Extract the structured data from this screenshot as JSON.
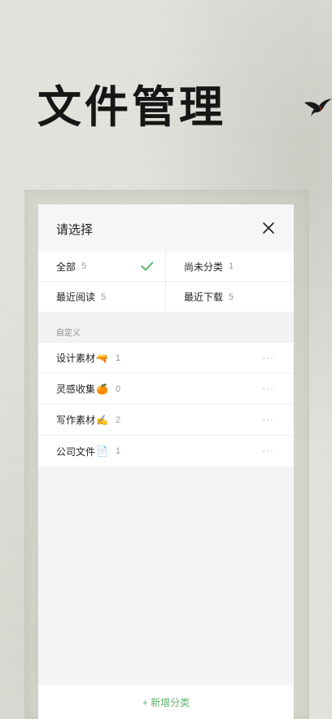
{
  "page": {
    "title": "文件管理"
  },
  "sheet": {
    "title": "请选择",
    "close_icon": "close-icon"
  },
  "filters": [
    {
      "label": "全部",
      "count": "5",
      "selected": true
    },
    {
      "label": "尚未分类",
      "count": "1",
      "selected": false
    },
    {
      "label": "最近阅读",
      "count": "5",
      "selected": false
    },
    {
      "label": "最近下载",
      "count": "5",
      "selected": false
    }
  ],
  "custom": {
    "section_label": "自定义",
    "items": [
      {
        "label": "设计素材",
        "emoji": "🔫",
        "count": "1",
        "more": "···"
      },
      {
        "label": "灵感收集",
        "emoji": "🍊",
        "count": "0",
        "more": "···"
      },
      {
        "label": "写作素材",
        "emoji": "✍️",
        "count": "2",
        "more": "···"
      },
      {
        "label": "公司文件",
        "emoji": "📄",
        "count": "1",
        "more": "···"
      }
    ]
  },
  "footer": {
    "add_label": "+ 新增分类"
  },
  "colors": {
    "accent": "#5cb46e",
    "title": "#161616",
    "count": "#9a9a9a"
  }
}
